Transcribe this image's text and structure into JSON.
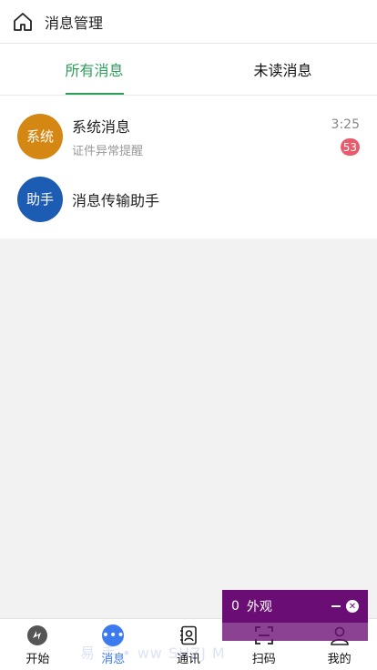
{
  "header": {
    "title": "消息管理",
    "home_icon": "home-icon"
  },
  "tabs": [
    {
      "label": "所有消息",
      "active": true
    },
    {
      "label": "未读消息",
      "active": false
    }
  ],
  "messages": [
    {
      "avatar_text": "系统",
      "avatar_color": "#d48712",
      "name": "系统消息",
      "preview": "证件异常提醒",
      "time": "3:25",
      "badge": "53"
    },
    {
      "avatar_text": "助手",
      "avatar_color": "#1d5cb3",
      "name": "消息传输助手",
      "preview": "",
      "time": "",
      "badge": ""
    }
  ],
  "bottom_nav": [
    {
      "label": "开始",
      "icon": "start-logo-icon",
      "active": false
    },
    {
      "label": "消息",
      "icon": "chat-dots-icon",
      "active": true
    },
    {
      "label": "通讯",
      "icon": "contacts-icon",
      "active": false
    },
    {
      "label": "扫码",
      "icon": "scan-icon",
      "active": false
    },
    {
      "label": "我的",
      "icon": "profile-icon",
      "active": false
    }
  ],
  "floating_panel": {
    "count": "0",
    "label": "外观"
  },
  "watermark": "易  手 • ww SHZJ    M",
  "colors": {
    "accent_green": "#2e9e5b",
    "accent_blue": "#3b7bef",
    "badge_red": "#e95b6b",
    "panel_purple": "#6a0d75"
  }
}
